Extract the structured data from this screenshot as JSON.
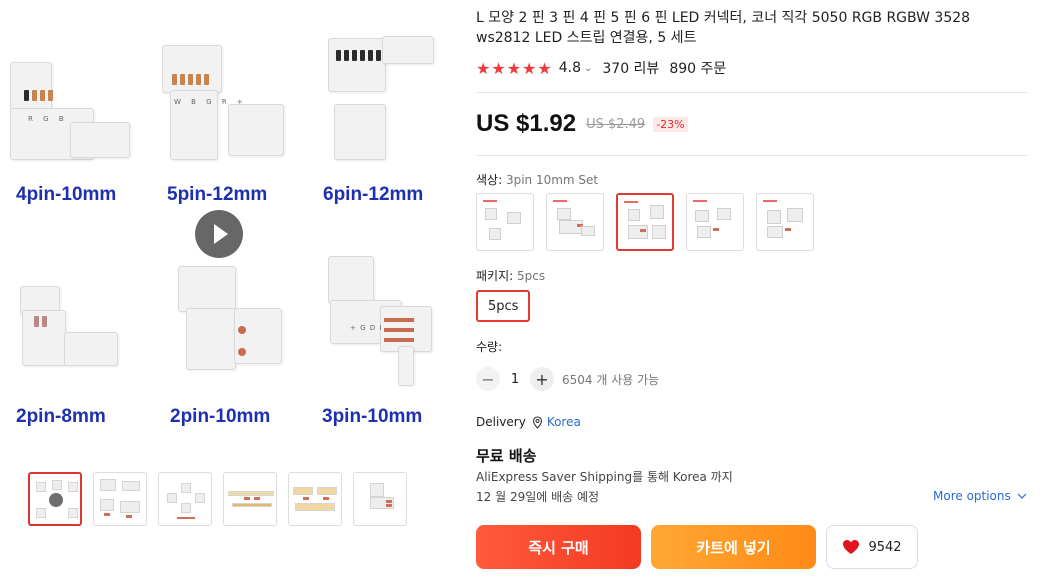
{
  "gallery": {
    "captions": {
      "p1": "4pin-10mm",
      "p2": "5pin-12mm",
      "p3": "6pin-12mm",
      "p4": "2pin-8mm",
      "p5": "2pin-10mm",
      "p6": "3pin-10mm"
    },
    "pin_markings": {
      "p1": "R G B",
      "p2": "W B G R +",
      "p6": "+ G D I"
    },
    "thumbnail_count": 6,
    "active_thumbnail": 1
  },
  "product": {
    "title": "L 모양 2 핀 3 핀 4 핀 5 핀 6 핀 LED 커넥터, 코너 직각 5050 RGB RGBW 3528 ws2812 LED 스트립 연결용, 5 세트",
    "rating": "4.8",
    "stars": 5,
    "reviews": "370 리뷰",
    "orders": "890 주문"
  },
  "price": {
    "current": "US $1.92",
    "original": "US $2.49",
    "discount": "-23%"
  },
  "options": {
    "color_label": "색상:",
    "color_value": "3pin 10mm Set",
    "swatch_count": 5,
    "active_swatch": 3,
    "package_label": "패키지:",
    "package_value": "5pcs",
    "package_option": "5pcs"
  },
  "quantity": {
    "label": "수량:",
    "minus": "−",
    "value": "1",
    "plus": "+",
    "available": "6504 개 사용 가능"
  },
  "delivery": {
    "label": "Delivery",
    "country": "Korea",
    "shipping_title": "무료 배송",
    "shipping_desc": "AliExpress Saver Shipping를 통해 Korea 까지",
    "date": "12 월 29일에 배송 예정",
    "more_options": "More options"
  },
  "actions": {
    "buy_now": "즉시 구매",
    "add_to_cart": "카트에 넣기",
    "wishlist_count": "9542"
  },
  "colors": {
    "accent_red": "#e23a31",
    "buy_gradient": "#ff5a3c",
    "cart_gradient": "#ff8a16",
    "link_blue": "#2b6ccf",
    "caption_blue": "#1e2fb0"
  }
}
